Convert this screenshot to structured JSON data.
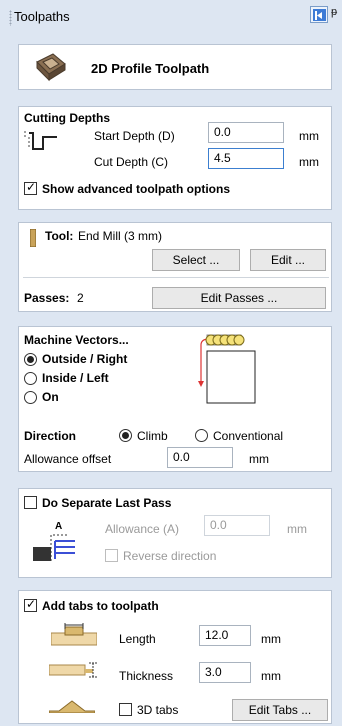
{
  "window": {
    "title": "Toolpaths",
    "pin_glyph": "ᵽ"
  },
  "header": {
    "title": "2D Profile Toolpath",
    "icon": "profile-toolpath-icon"
  },
  "cutting_depths": {
    "section_title": "Cutting Depths",
    "start_label": "Start Depth (D)",
    "start_value": "0.0",
    "start_unit": "mm",
    "cut_label": "Cut Depth (C)",
    "cut_value": "4.5",
    "cut_unit": "mm",
    "advanced_label": "Show advanced toolpath options",
    "advanced_checked": true
  },
  "tool": {
    "label": "Tool:",
    "name": "End Mill (3 mm)",
    "select_label": "Select ...",
    "edit_label": "Edit ...",
    "passes_label": "Passes:",
    "passes_value": "2",
    "edit_passes_label": "Edit Passes ..."
  },
  "machine_vectors": {
    "section_title": "Machine Vectors...",
    "options": [
      "Outside / Right",
      "Inside / Left",
      "On"
    ],
    "selected": "Outside / Right",
    "direction_label": "Direction",
    "direction_options": [
      "Climb",
      "Conventional"
    ],
    "direction_selected": "Climb",
    "allowance_label": "Allowance offset",
    "allowance_value": "0.0",
    "allowance_unit": "mm"
  },
  "separate_last_pass": {
    "label": "Do Separate Last Pass",
    "checked": false,
    "allowance_label": "Allowance (A)",
    "allowance_value": "0.0",
    "allowance_unit": "mm",
    "reverse_label": "Reverse direction",
    "reverse_checked": false,
    "diagram_letter": "A"
  },
  "tabs": {
    "label": "Add tabs to toolpath",
    "checked": true,
    "length_label": "Length",
    "length_value": "12.0",
    "length_unit": "mm",
    "thickness_label": "Thickness",
    "thickness_value": "3.0",
    "thickness_unit": "mm",
    "tabs3d_label": "3D tabs",
    "tabs3d_checked": false,
    "edit_tabs_label": "Edit Tabs ..."
  },
  "colors": {
    "accent": "#3c7fd0",
    "background": "#dde6f2",
    "panel_border": "#b9c4d3"
  }
}
